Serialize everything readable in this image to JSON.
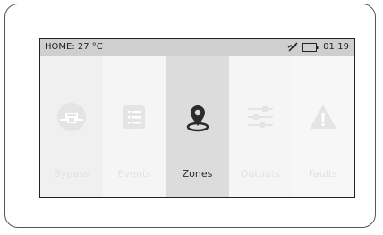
{
  "statusbar": {
    "location_temp": "HOME: 27 °C",
    "time": "01:19",
    "icons": [
      "no-signal-icon",
      "battery-icon"
    ]
  },
  "menu": {
    "active_index": 2,
    "tiles": [
      {
        "label": "Bypass",
        "icon": "bypass-icon"
      },
      {
        "label": "Events",
        "icon": "events-list-icon"
      },
      {
        "label": "Zones",
        "icon": "location-pin-icon"
      },
      {
        "label": "Outputs",
        "icon": "sliders-icon"
      },
      {
        "label": "Faults",
        "icon": "warning-triangle-icon"
      }
    ]
  },
  "colors": {
    "frame": "#555555",
    "statusbar_bg": "#cfcfcf",
    "active_tile_bg": "#dcdcdc",
    "inactive_icon": "#e4e4e4",
    "active_icon": "#2b2b2b"
  }
}
